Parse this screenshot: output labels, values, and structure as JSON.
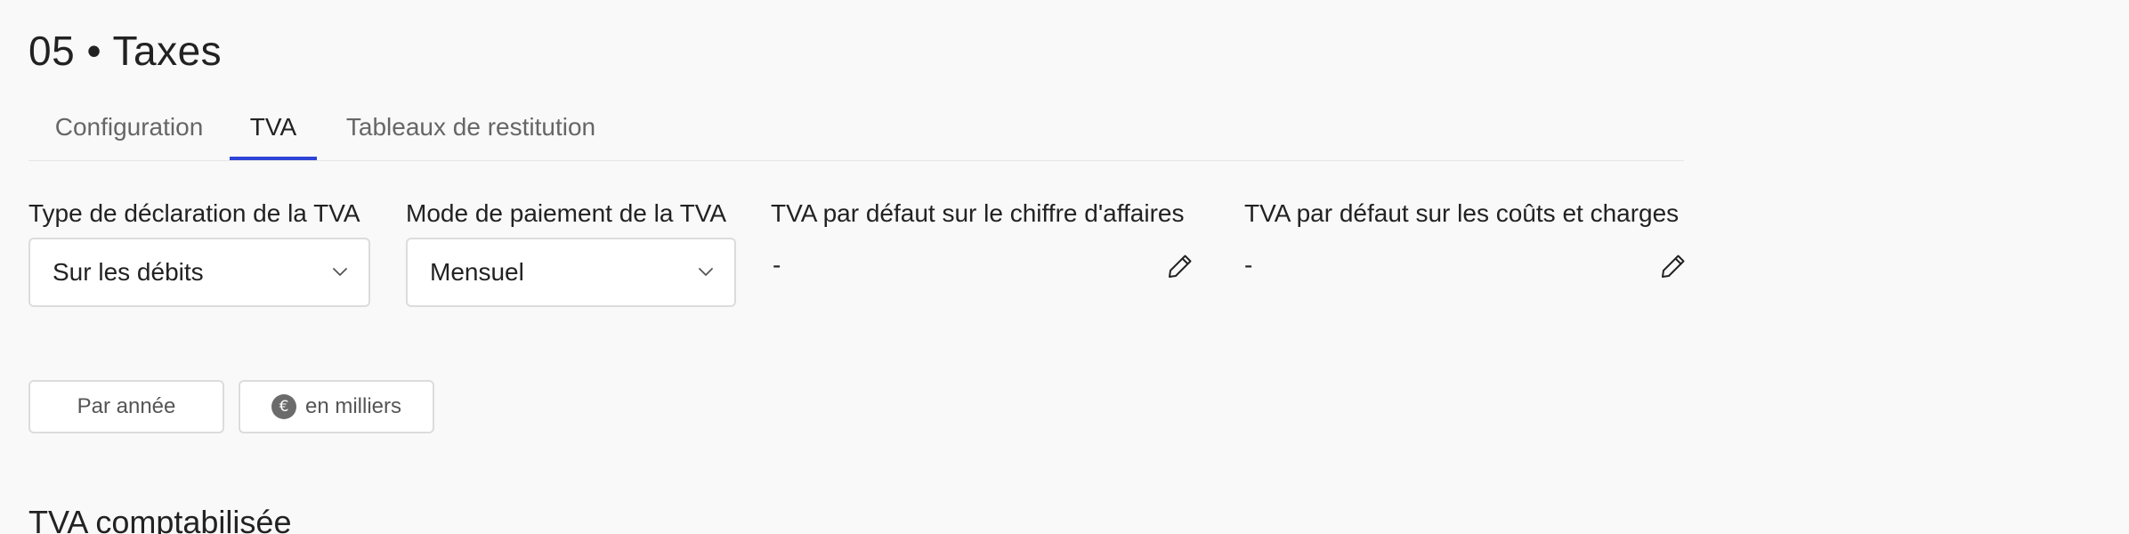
{
  "page": {
    "title": "05 • Taxes"
  },
  "tabs": [
    {
      "label": "Configuration",
      "active": false
    },
    {
      "label": "TVA",
      "active": true
    },
    {
      "label": "Tableaux de restitution",
      "active": false
    }
  ],
  "fields": {
    "declaration_type": {
      "label": "Type de déclaration de la TVA",
      "value": "Sur les débits"
    },
    "payment_mode": {
      "label": "Mode de paiement de la TVA",
      "value": "Mensuel"
    },
    "default_vat_revenue": {
      "label": "TVA par défaut sur le chiffre d'affaires",
      "value": "-"
    },
    "default_vat_costs": {
      "label": "TVA par défaut sur les coûts et charges",
      "value": "-"
    }
  },
  "toolbar": {
    "period_label": "Par année",
    "currency_symbol": "€",
    "unit_label": "en milliers"
  },
  "section": {
    "title": "TVA comptabilisée"
  },
  "colors": {
    "accent": "#2e44d6",
    "background": "#f9f9f9"
  },
  "icons": {
    "select_chevron": "chevron-down-icon",
    "edit": "pencil-icon"
  }
}
